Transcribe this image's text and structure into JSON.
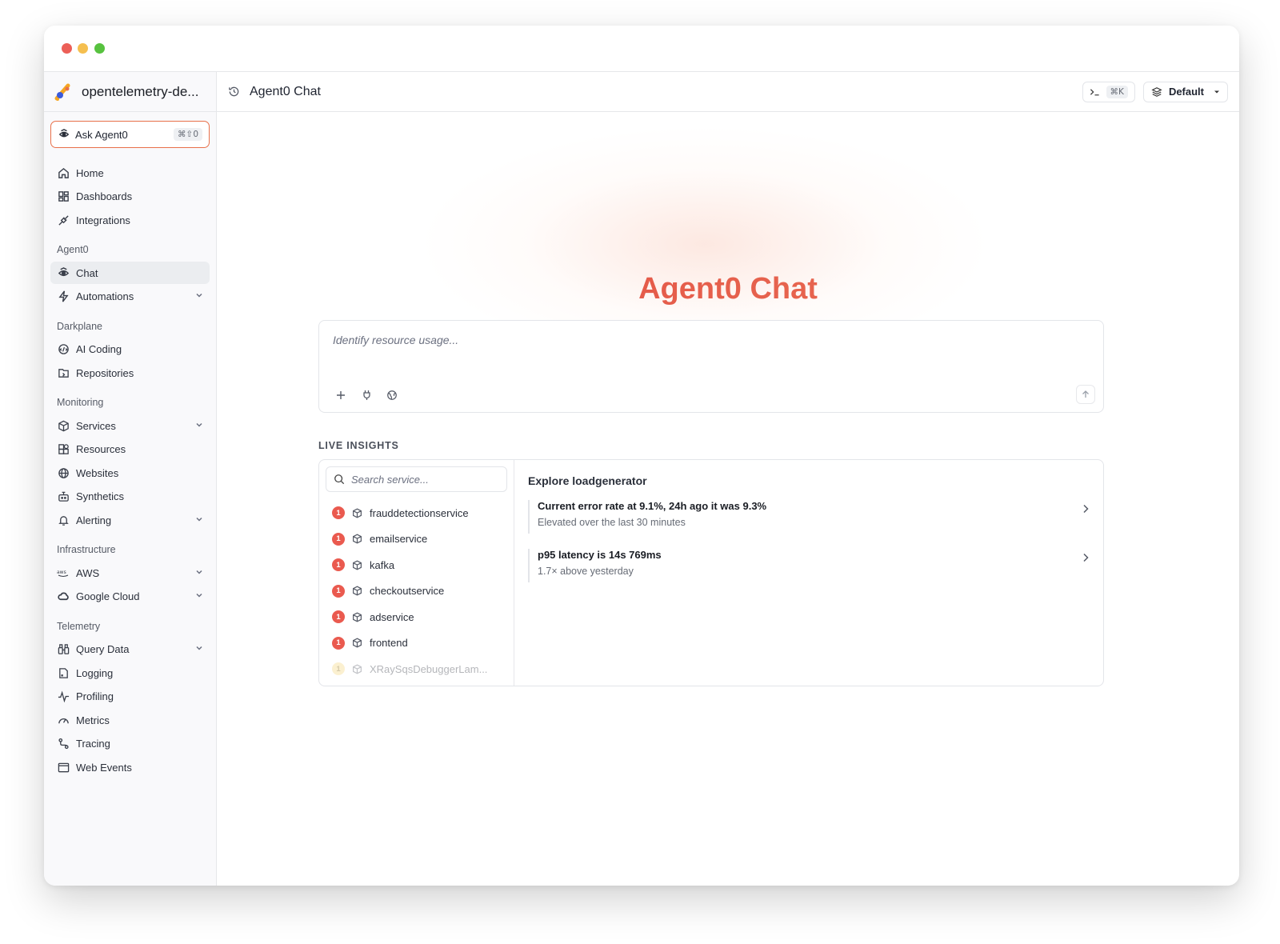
{
  "window": {
    "title": "Agent0 Chat"
  },
  "org": {
    "name": "opentelemetry-de..."
  },
  "ask": {
    "label": "Ask Agent0",
    "shortcut": "⌘⇧0"
  },
  "nav": {
    "top": [
      {
        "label": "Home",
        "icon": "home-icon"
      },
      {
        "label": "Dashboards",
        "icon": "dashboards-icon"
      },
      {
        "label": "Integrations",
        "icon": "plug-icon"
      }
    ],
    "sections": [
      {
        "title": "Agent0",
        "items": [
          {
            "label": "Chat",
            "icon": "agent-icon",
            "active": true
          },
          {
            "label": "Automations",
            "icon": "bolt-icon",
            "expandable": true
          }
        ]
      },
      {
        "title": "Darkplane",
        "items": [
          {
            "label": "AI Coding",
            "icon": "ai-coding-icon"
          },
          {
            "label": "Repositories",
            "icon": "repo-icon"
          }
        ]
      },
      {
        "title": "Monitoring",
        "items": [
          {
            "label": "Services",
            "icon": "cube-icon",
            "expandable": true
          },
          {
            "label": "Resources",
            "icon": "resources-icon"
          },
          {
            "label": "Websites",
            "icon": "globe-icon"
          },
          {
            "label": "Synthetics",
            "icon": "robot-icon"
          },
          {
            "label": "Alerting",
            "icon": "bell-icon",
            "expandable": true
          }
        ]
      },
      {
        "title": "Infrastructure",
        "items": [
          {
            "label": "AWS",
            "icon": "aws-icon",
            "expandable": true
          },
          {
            "label": "Google Cloud",
            "icon": "cloud-icon",
            "expandable": true
          }
        ]
      },
      {
        "title": "Telemetry",
        "items": [
          {
            "label": "Query Data",
            "icon": "binoculars-icon",
            "expandable": true
          },
          {
            "label": "Logging",
            "icon": "log-icon"
          },
          {
            "label": "Profiling",
            "icon": "pulse-icon"
          },
          {
            "label": "Metrics",
            "icon": "gauge-icon"
          },
          {
            "label": "Tracing",
            "icon": "trace-icon"
          },
          {
            "label": "Web Events",
            "icon": "browser-icon"
          }
        ]
      }
    ]
  },
  "topbar": {
    "title": "Agent0 Chat",
    "command_shortcut": "⌘K",
    "environment": "Default"
  },
  "hero": {
    "title": "Agent0 Chat"
  },
  "composer": {
    "placeholder": "Identify resource usage..."
  },
  "insights": {
    "label": "LIVE INSIGHTS",
    "search_placeholder": "Search service...",
    "services": [
      {
        "name": "frauddetectionservice",
        "count": "1",
        "status": "error"
      },
      {
        "name": "emailservice",
        "count": "1",
        "status": "error"
      },
      {
        "name": "kafka",
        "count": "1",
        "status": "error"
      },
      {
        "name": "checkoutservice",
        "count": "1",
        "status": "error"
      },
      {
        "name": "adservice",
        "count": "1",
        "status": "error"
      },
      {
        "name": "frontend",
        "count": "1",
        "status": "error"
      },
      {
        "name": "XRaySqsDebuggerLam...",
        "count": "1",
        "status": "warning"
      }
    ],
    "detail_title": "Explore loadgenerator",
    "items": [
      {
        "headline": "Current error rate at 9.1%, 24h ago it was 9.3%",
        "sub": "Elevated over the last 30 minutes"
      },
      {
        "headline": "p95 latency is 14s 769ms",
        "sub": "1.7× above yesterday"
      }
    ]
  },
  "colors": {
    "accent": "#e8704a",
    "error": "#ea5a4f",
    "warning": "#f6d57a"
  }
}
